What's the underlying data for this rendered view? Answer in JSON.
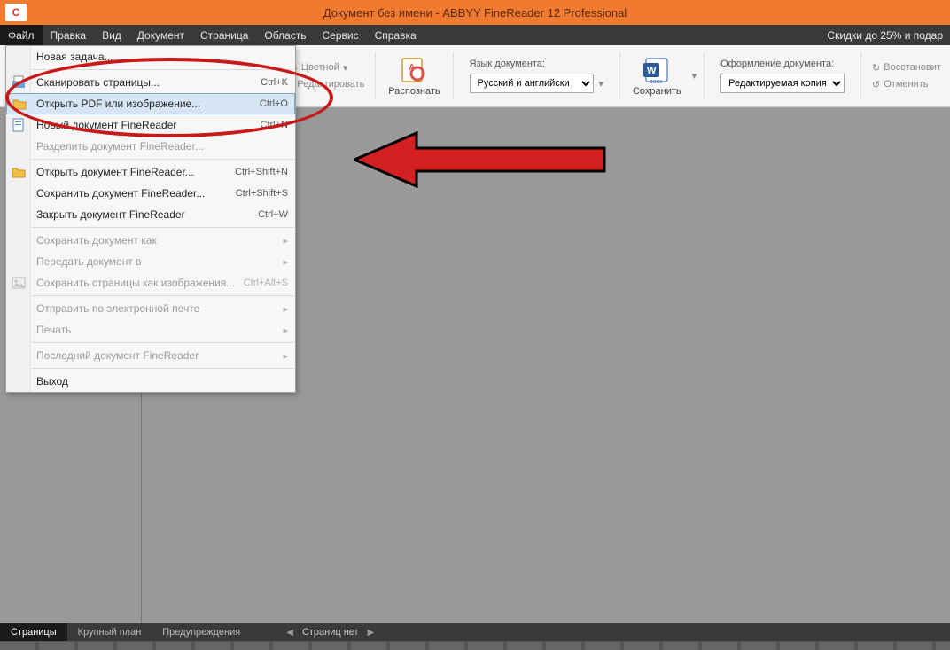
{
  "titlebar": {
    "title": "Документ без имени - ABBYY FineReader 12 Professional"
  },
  "menubar": {
    "items": [
      "Файл",
      "Правка",
      "Вид",
      "Документ",
      "Страница",
      "Область",
      "Сервис",
      "Справка"
    ],
    "promo": "Скидки до 25% и подар"
  },
  "toolbar": {
    "color_mode": "Цветной",
    "edit_label": "Редактировать",
    "recognize": "Распознать",
    "lang_label": "Язык документа:",
    "lang_value": "Русский и английски",
    "save": "Сохранить",
    "format_label": "Оформление документа:",
    "format_value": "Редактируемая копия",
    "restore": "Восстановит",
    "undo": "Отменить"
  },
  "dropdown": {
    "items": [
      {
        "label": "Новая задача...",
        "shortcut": "",
        "disabled": false,
        "sep_after": true
      },
      {
        "label": "Сканировать страницы...",
        "shortcut": "Ctrl+K",
        "disabled": false,
        "icon": "scanner"
      },
      {
        "label": "Открыть PDF или изображение...",
        "shortcut": "Ctrl+O",
        "disabled": false,
        "highlight": true,
        "icon": "folder"
      },
      {
        "label": "Новый документ FineReader",
        "shortcut": "Ctrl+N",
        "disabled": false,
        "icon": "doc"
      },
      {
        "label": "Разделить документ FineReader...",
        "shortcut": "",
        "disabled": true,
        "sep_after": true
      },
      {
        "label": "Открыть документ FineReader...",
        "shortcut": "Ctrl+Shift+N",
        "disabled": false,
        "icon": "folder2"
      },
      {
        "label": "Сохранить документ FineReader...",
        "shortcut": "Ctrl+Shift+S",
        "disabled": false
      },
      {
        "label": "Закрыть документ FineReader",
        "shortcut": "Ctrl+W",
        "disabled": false,
        "sep_after": true
      },
      {
        "label": "Сохранить документ как",
        "shortcut": "",
        "disabled": true,
        "chev": true
      },
      {
        "label": "Передать документ в",
        "shortcut": "",
        "disabled": true,
        "chev": true
      },
      {
        "label": "Сохранить страницы как изображения...",
        "shortcut": "Ctrl+Alt+S",
        "disabled": true,
        "icon": "img",
        "sep_after": true
      },
      {
        "label": "Отправить по электронной почте",
        "shortcut": "",
        "disabled": true,
        "chev": true
      },
      {
        "label": "Печать",
        "shortcut": "",
        "disabled": true,
        "chev": true,
        "sep_after": true
      },
      {
        "label": "Последний документ FineReader",
        "shortcut": "",
        "disabled": true,
        "chev": true,
        "sep_after": true
      },
      {
        "label": "Выход",
        "shortcut": "",
        "disabled": false
      }
    ]
  },
  "statusbar": {
    "tabs": [
      "Страницы",
      "Крупный план",
      "Предупреждения"
    ],
    "pages_info": "Страниц нет"
  }
}
